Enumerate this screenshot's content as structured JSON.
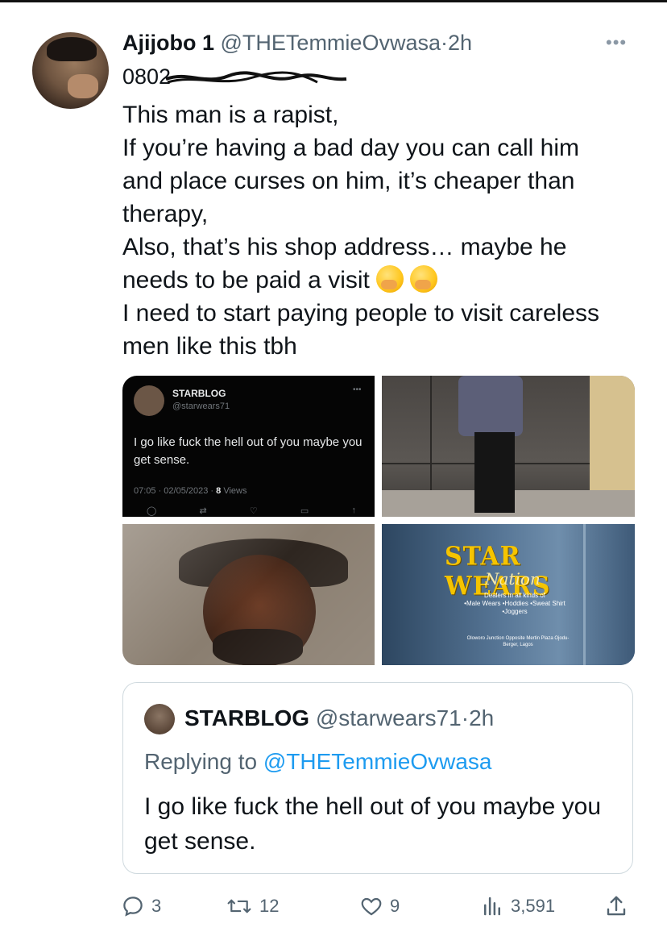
{
  "tweet": {
    "author_name": "Ajijobo 1",
    "author_handle": "@THETemmieOvwasa",
    "separator": "·",
    "time": "2h",
    "more": "•••",
    "phone_visible": "0802",
    "lines": [
      "This man is a rapist,",
      "If you’re having a bad day you can call him",
      "and place curses on him, it’s cheaper than",
      "therapy,",
      "Also, that’s his shop address… maybe he",
      "needs to be paid a visit",
      "I need to start paying people to visit careless",
      "men like this tbh"
    ],
    "emoji": [
      "face-with-hand-over-mouth",
      "face-with-hand-over-mouth"
    ]
  },
  "media": {
    "embedded_tweet": {
      "name": "STARBLOG",
      "handle": "@starwears71",
      "more": "•••",
      "text": "I go like fuck the hell out of you maybe you get sense.",
      "meta_time": "07:05 · 02/05/2023 · ",
      "meta_views": "8",
      "meta_views_label": " Views"
    },
    "sign": {
      "title": "STAR WEARS",
      "subtitle": "Nation",
      "line1": "Dealers in all kinds of",
      "line2": "•Male Wears •Hoddies •Sweat Shirt",
      "line3": "•Joggers",
      "address": "Oloworo Junction Opposite Mertin Plaza Ojodu-Berger, Lagos"
    }
  },
  "quoted": {
    "name": "STARBLOG",
    "handle": "@starwears71",
    "separator": "·",
    "time": "2h",
    "replying_prefix": "Replying to ",
    "replying_handle": "@THETemmieOvwasa",
    "text": "I go like fuck the hell out of you maybe you get sense."
  },
  "actions": {
    "replies": "3",
    "retweets": "12",
    "likes": "9",
    "views": "3,591"
  },
  "colors": {
    "text": "#0f1419",
    "secondary": "#536471",
    "link": "#1d9bf0",
    "border": "#cfd9de"
  }
}
